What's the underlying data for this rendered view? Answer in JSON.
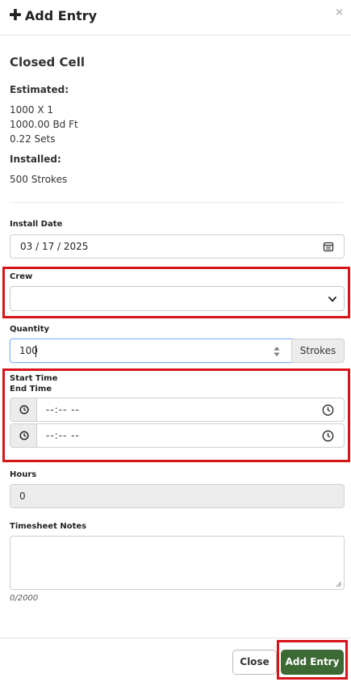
{
  "modal": {
    "title": "Add Entry",
    "close_symbol": "×",
    "plus_symbol": "✚"
  },
  "summary": {
    "title": "Closed Cell",
    "estimated_label": "Estimated:",
    "estimated_lines": [
      "1000 X 1",
      "1000.00 Bd Ft",
      "0.22 Sets"
    ],
    "installed_label": "Installed:",
    "installed_value": "500 Strokes"
  },
  "form": {
    "install_date": {
      "label": "Install Date",
      "value": "03 / 17 / 2025"
    },
    "crew": {
      "label": "Crew",
      "value": ""
    },
    "quantity": {
      "label": "Quantity",
      "value": "100",
      "unit": "Strokes"
    },
    "start_time": {
      "label": "Start Time",
      "value": "--:-- --"
    },
    "end_time": {
      "label": "End Time",
      "value": "--:-- --"
    },
    "hours": {
      "label": "Hours",
      "value": "0"
    },
    "notes": {
      "label": "Timesheet Notes",
      "value": "",
      "counter": "0/2000"
    }
  },
  "footer": {
    "close_label": "Close",
    "add_label": "Add Entry",
    "add_color": "#3d6a34"
  },
  "highlight_color": "#d8141b",
  "icons": [
    "plus-icon",
    "close-icon",
    "calendar-icon",
    "chevron-down-icon",
    "spinner-icon",
    "clock-icon",
    "resize-grip-icon"
  ]
}
